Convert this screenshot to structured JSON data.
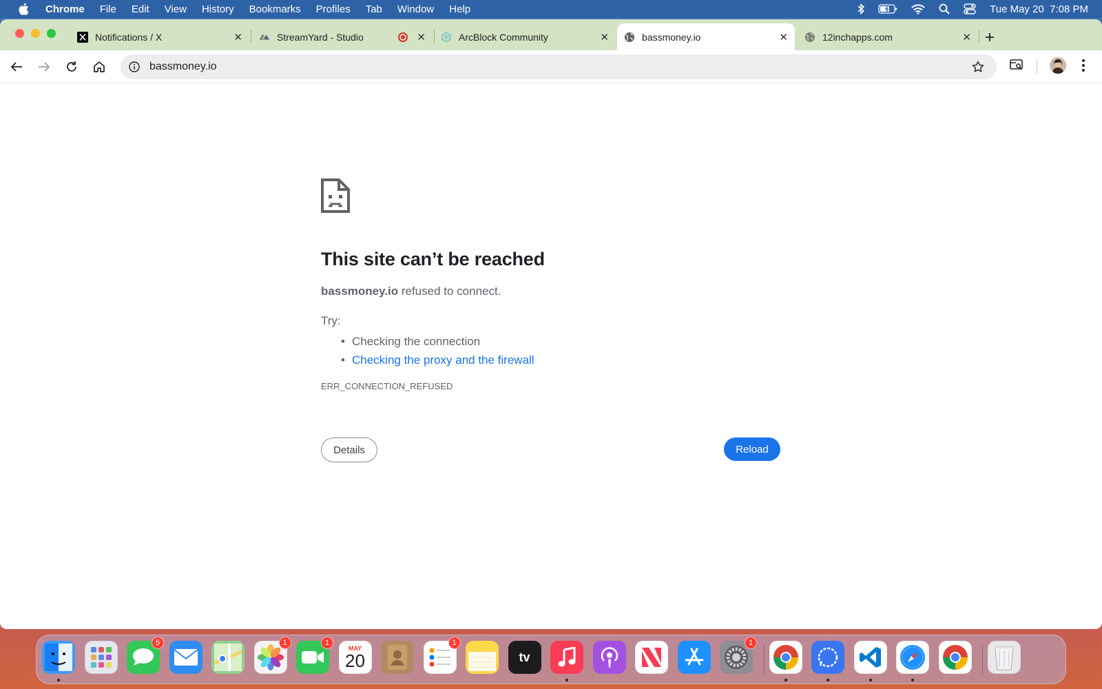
{
  "menubar": {
    "app_name": "Chrome",
    "items": [
      "File",
      "Edit",
      "View",
      "History",
      "Bookmarks",
      "Profiles",
      "Tab",
      "Window",
      "Help"
    ],
    "clock": "Tue May 20  7:08 PM",
    "status_icons": [
      "bluetooth-icon",
      "battery-icon",
      "wifi-icon",
      "spotlight-icon",
      "control-center-icon"
    ]
  },
  "tabs": [
    {
      "title": "Notifications / X",
      "icon": "x-logo-icon",
      "active": false
    },
    {
      "title": "StreamYard - Studio",
      "icon": "streamyard-icon",
      "active": false,
      "recording": true
    },
    {
      "title": "ArcBlock Community",
      "icon": "arcblock-icon",
      "active": false
    },
    {
      "title": "bassmoney.io",
      "icon": "globe-icon",
      "active": true
    },
    {
      "title": "12inchapps.com",
      "icon": "globe-icon",
      "active": false
    }
  ],
  "omnibox": {
    "url": "bassmoney.io"
  },
  "error_page": {
    "title": "This site can’t be reached",
    "host": "bassmoney.io",
    "message": " refused to connect.",
    "try_label": "Try:",
    "suggestions": [
      {
        "text": "Checking the connection",
        "link": false
      },
      {
        "text": "Checking the proxy and the firewall",
        "link": true
      }
    ],
    "error_code": "ERR_CONNECTION_REFUSED",
    "details_button": "Details",
    "reload_button": "Reload"
  },
  "dock": {
    "apps": [
      {
        "name": "Finder",
        "icon": "finder-icon",
        "color": "#3b9cf5",
        "running": true
      },
      {
        "name": "Launchpad",
        "icon": "launchpad-icon",
        "color": "#e6e6ee"
      },
      {
        "name": "Messages",
        "icon": "messages-icon",
        "color": "#33c759",
        "badge": "5"
      },
      {
        "name": "Mail",
        "icon": "mail-icon",
        "color": "#2f8cf0"
      },
      {
        "name": "Maps",
        "icon": "maps-icon",
        "color": "#8fd18f"
      },
      {
        "name": "Photos",
        "icon": "photos-icon",
        "color": "#f4f4f4",
        "badge": "1"
      },
      {
        "name": "FaceTime",
        "icon": "facetime-icon",
        "color": "#34c759",
        "badge": "1"
      },
      {
        "name": "Calendar",
        "icon": "calendar-icon",
        "color": "#ffffff",
        "month": "MAY",
        "day": "20"
      },
      {
        "name": "Contacts",
        "icon": "contacts-icon",
        "color": "#b08a60"
      },
      {
        "name": "Reminders",
        "icon": "reminders-icon",
        "color": "#ffffff",
        "badge": "1"
      },
      {
        "name": "Notes",
        "icon": "notes-icon",
        "color": "#fcd94a"
      },
      {
        "name": "TV",
        "icon": "apple-tv-icon",
        "color": "#1c1c1e",
        "label": "tv"
      },
      {
        "name": "Music",
        "icon": "music-icon",
        "color": "#fa3c55",
        "running": true
      },
      {
        "name": "Podcasts",
        "icon": "podcasts-icon",
        "color": "#a450e0"
      },
      {
        "name": "News",
        "icon": "news-icon",
        "color": "#ffffff"
      },
      {
        "name": "App Store",
        "icon": "app-store-icon",
        "color": "#1e90ff"
      },
      {
        "name": "System Settings",
        "icon": "settings-icon",
        "color": "#8e8e93",
        "badge": "1"
      },
      {
        "name": "Google Chrome",
        "icon": "chrome-icon",
        "color": "#ffffff",
        "running": true
      },
      {
        "name": "Signal",
        "icon": "signal-icon",
        "color": "#3a76f0",
        "running": true
      },
      {
        "name": "Visual Studio Code",
        "icon": "vscode-icon",
        "color": "#ffffff",
        "running": true
      },
      {
        "name": "Safari",
        "icon": "safari-icon",
        "color": "#ffffff",
        "running": true
      },
      {
        "name": "Chrome Canary",
        "icon": "chrome-icon",
        "color": "#ffffff"
      },
      {
        "name": "Trash",
        "icon": "trash-icon",
        "color": "#e8e8ec"
      }
    ]
  },
  "colors": {
    "link": "#1a73e8",
    "tabstrip": "#d3e3c4",
    "reload_button": "#1a73e8",
    "menubar": "#2e62a6"
  }
}
